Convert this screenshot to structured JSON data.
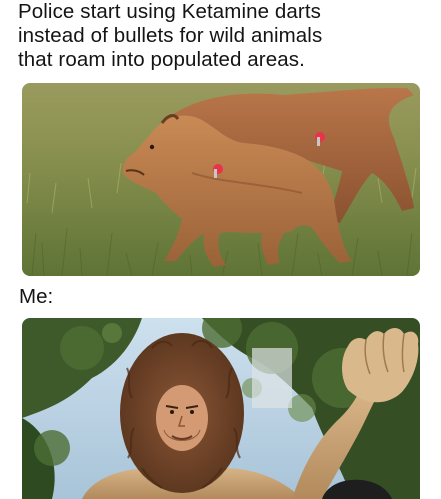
{
  "meme": {
    "caption_lines": [
      "Police start using Ketamine darts",
      "instead of bullets for wild animals",
      "that roam into populated areas."
    ],
    "reaction_label": "Me:"
  },
  "images": {
    "top_photo": {
      "icon": "lioness-photo",
      "colors": {
        "grass": "#7a8a4a",
        "fur": "#b77a4a",
        "dart": "#e8334a"
      }
    },
    "bottom_photo": {
      "icon": "cowardly-lion-costume-photo",
      "colors": {
        "mane": "#7a4a2e",
        "costume": "#c9a57a",
        "trees": "#3e5a2a",
        "sky": "#b9d4e8"
      }
    }
  }
}
